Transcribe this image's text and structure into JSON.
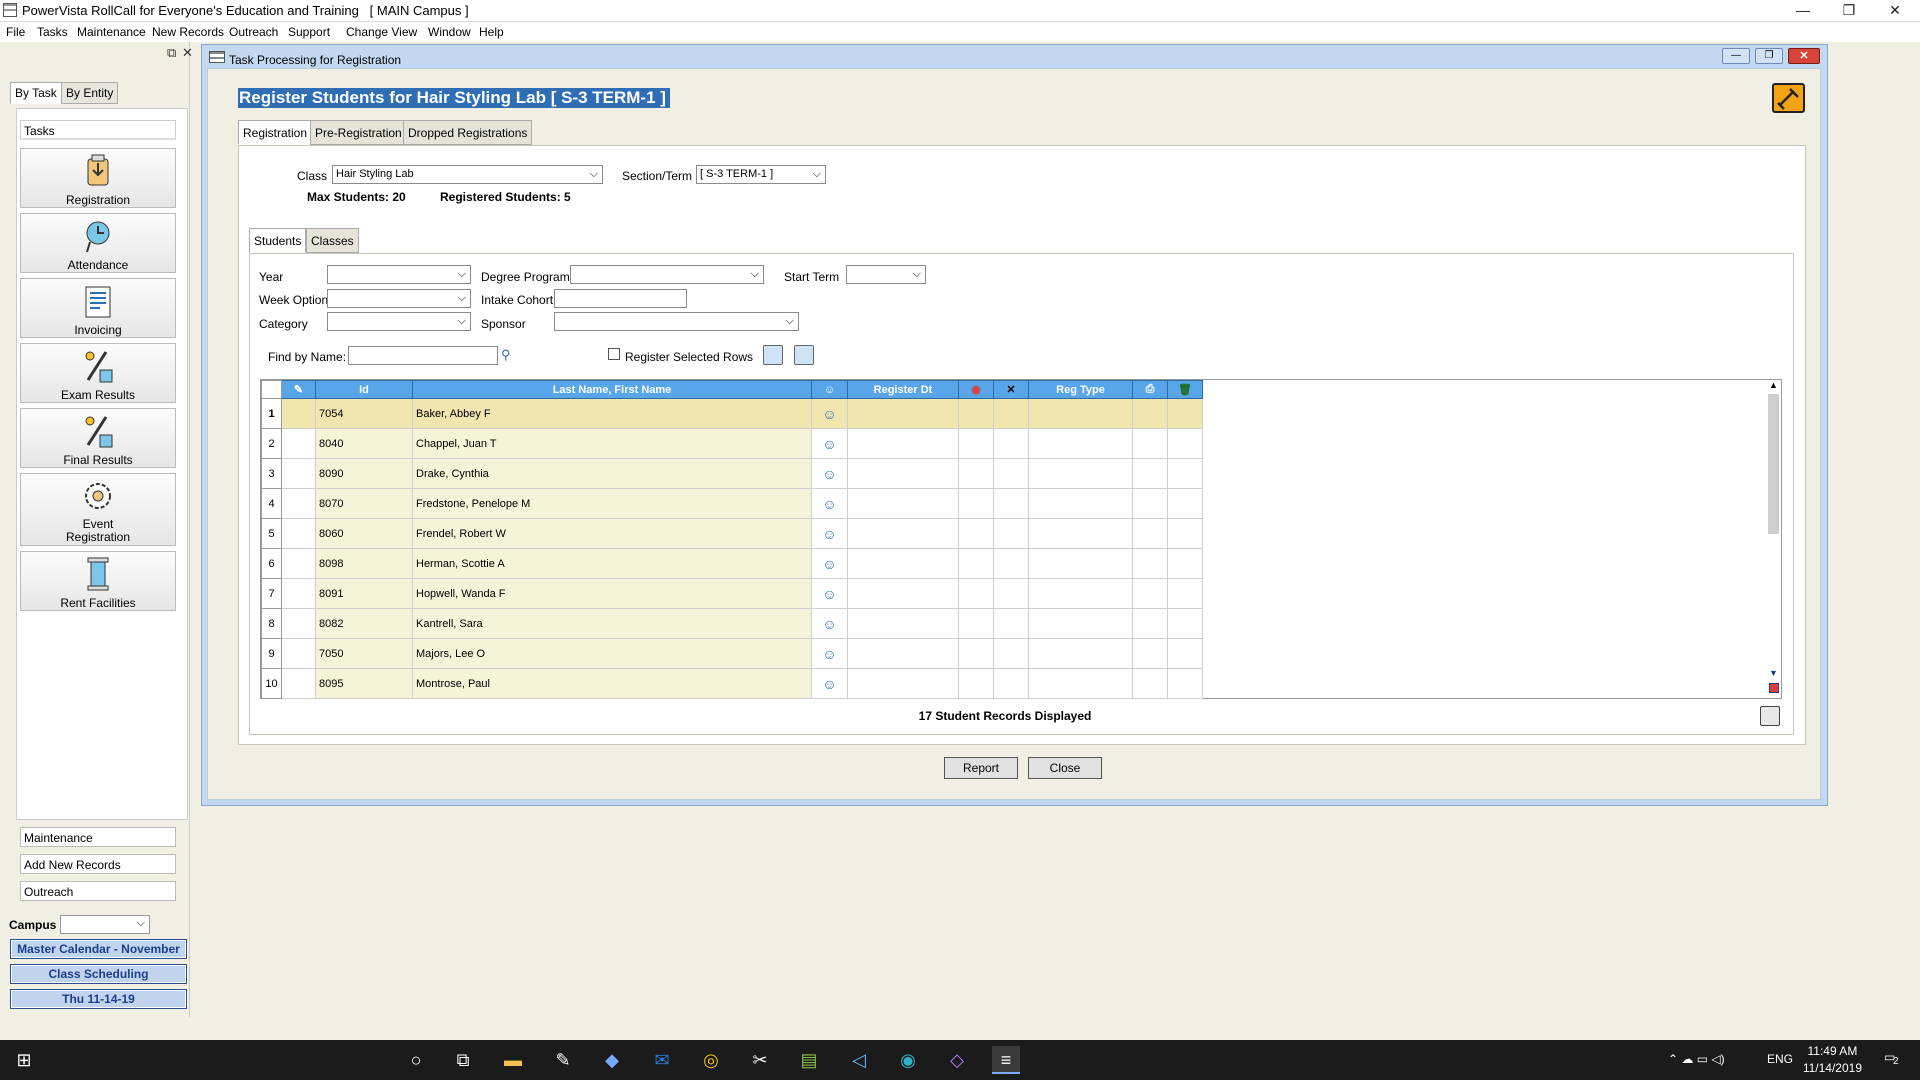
{
  "app": {
    "title": "PowerVista RollCall for Everyone's Education and Training   [ MAIN Campus ]",
    "window_controls": [
      "—",
      "❐",
      "✕"
    ]
  },
  "menu": [
    "File",
    "Tasks",
    "Maintenance",
    "New Records",
    "Outreach",
    "Support",
    "Change View",
    "Window",
    "Help"
  ],
  "left_panel": {
    "tabs": [
      "By Task",
      "By Entity"
    ],
    "tasks_header": "Tasks",
    "tasks": [
      {
        "label": "Registration",
        "icon": "registration-icon"
      },
      {
        "label": "Attendance",
        "icon": "attendance-icon"
      },
      {
        "label": "Invoicing",
        "icon": "invoicing-icon"
      },
      {
        "label": "Exam Results",
        "icon": "exam-results-icon"
      },
      {
        "label": "Final Results",
        "icon": "final-results-icon"
      },
      {
        "label": "Event Registration",
        "icon": "event-registration-icon"
      },
      {
        "label": "Rent Facilities",
        "icon": "rent-facilities-icon"
      }
    ],
    "bottom_items": [
      "Maintenance",
      "Add New Records",
      "Outreach"
    ],
    "campus_label": "Campus",
    "campus_value": "",
    "quick_buttons": [
      "Master Calendar - November",
      "Class Scheduling",
      "Thu 11-14-19"
    ]
  },
  "child_window": {
    "title": "Task Processing for Registration",
    "header": "Register Students for Hair Styling Lab [ S-3 TERM-1 ]",
    "tabs": [
      "Registration",
      "Pre-Registration",
      "Dropped Registrations"
    ],
    "class_label": "Class",
    "class_value": "Hair Styling Lab",
    "section_label": "Section/Term",
    "section_value": "[ S-3 TERM-1 ]",
    "max_students": "Max Students: 20",
    "registered_students": "Registered Students: 5",
    "inner_tabs": [
      "Students",
      "Classes"
    ],
    "filters": {
      "year_label": "Year",
      "degree_label": "Degree Program",
      "start_term_label": "Start Term",
      "week_option_label": "Week Option",
      "intake_label": "Intake Cohort",
      "category_label": "Category",
      "sponsor_label": "Sponsor"
    },
    "find_label": "Find by Name:",
    "find_value": "",
    "register_selected_label": "Register Selected Rows",
    "columns": [
      "",
      "Id",
      "Last Name, First Name",
      "",
      "Register Dt",
      "",
      "✕",
      "Reg Type",
      "",
      ""
    ],
    "rows": [
      {
        "n": "1",
        "id": "7054",
        "name": "Baker, Abbey F"
      },
      {
        "n": "2",
        "id": "8040",
        "name": "Chappel, Juan T"
      },
      {
        "n": "3",
        "id": "8090",
        "name": "Drake, Cynthia"
      },
      {
        "n": "4",
        "id": "8070",
        "name": "Fredstone, Penelope M"
      },
      {
        "n": "5",
        "id": "8060",
        "name": "Frendel, Robert W"
      },
      {
        "n": "6",
        "id": "8098",
        "name": "Herman, Scottie A"
      },
      {
        "n": "7",
        "id": "8091",
        "name": "Hopwell, Wanda F"
      },
      {
        "n": "8",
        "id": "8082",
        "name": "Kantrell, Sara"
      },
      {
        "n": "9",
        "id": "7050",
        "name": "Majors, Lee O"
      },
      {
        "n": "10",
        "id": "8095",
        "name": "Montrose, Paul"
      }
    ],
    "records_displayed": "17 Student Records Displayed",
    "report_button": "Report",
    "close_button": "Close"
  },
  "taskbar": {
    "time": "11:49 AM",
    "date": "11/14/2019",
    "lang": "ENG",
    "notif_count": "2"
  }
}
